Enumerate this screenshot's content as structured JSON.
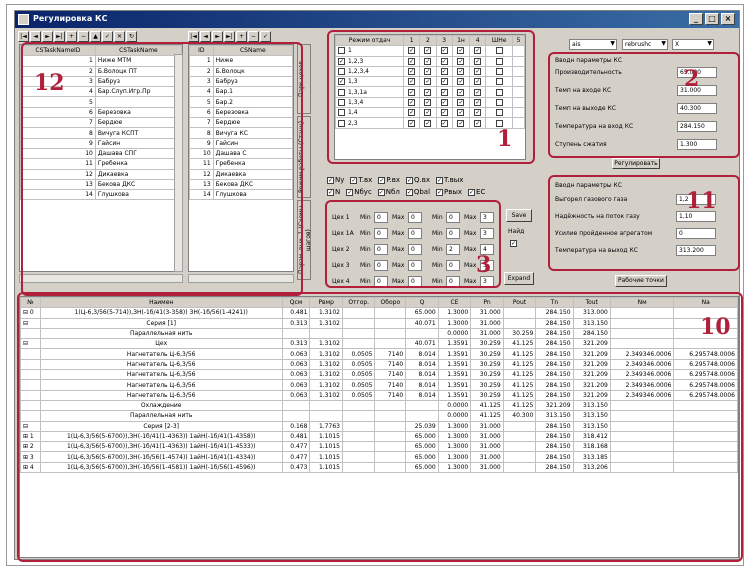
{
  "window": {
    "title": "Регулировка КС",
    "controls": [
      "_",
      "□",
      "×"
    ]
  },
  "nav_buttons": [
    "|◄",
    "◄",
    "►",
    "►|",
    "+",
    "−",
    "▲",
    "✓",
    "✕",
    "↻"
  ],
  "left_grid": {
    "headers": [
      "CSTaskNameID",
      "CSTaskName"
    ],
    "rows": [
      [
        "1",
        "Ниже МТМ"
      ],
      [
        "2",
        "Б.Волоцк ПТ"
      ],
      [
        "3",
        "Бабруз"
      ],
      [
        "4",
        "Бар.Слуп.Игр.Пр"
      ],
      [
        "5",
        ""
      ],
      [
        "6",
        "Березовка"
      ],
      [
        "7",
        "Бердюе"
      ],
      [
        "8",
        "Вичуга КСПТ"
      ],
      [
        "9",
        "Гайсин"
      ],
      [
        "10",
        "Дашава СПГ"
      ],
      [
        "11",
        "Гребенка"
      ],
      [
        "12",
        "Дикаевка"
      ],
      [
        "13",
        "Бекова ДКС"
      ],
      [
        "14",
        "Глушкова"
      ]
    ]
  },
  "mid_grid": {
    "headers": [
      "ID",
      "CSName"
    ],
    "rows": [
      [
        "1",
        "Ниже"
      ],
      [
        "2",
        "Б.Волоцк"
      ],
      [
        "3",
        "Бабруз"
      ],
      [
        "4",
        "Бар.1"
      ],
      [
        "5",
        "Бар.2"
      ],
      [
        "6",
        "Березовка"
      ],
      [
        "7",
        "Бердюе"
      ],
      [
        "8",
        "Вичуга КС"
      ],
      [
        "9",
        "Гайсин"
      ],
      [
        "10",
        "Дашава С"
      ],
      [
        "11",
        "Гребенка"
      ],
      [
        "12",
        "Дикаевка"
      ],
      [
        "13",
        "Бекова ДКС"
      ],
      [
        "14",
        "Глушкова"
      ]
    ]
  },
  "vertical_tabs": [
    "Парк цехов",
    "Режим работы (Станц)",
    "Парам. вых. 1 (Схемы шагов)"
  ],
  "modes_grid": {
    "headers": [
      "Режим отдач",
      "1",
      "2",
      "3",
      "1н",
      "4",
      "ШНе",
      "5"
    ],
    "rows": [
      {
        "checked": false,
        "label": "1"
      },
      {
        "checked": true,
        "label": "1,2,3"
      },
      {
        "checked": false,
        "label": "1,2,3,4"
      },
      {
        "checked": true,
        "label": "1,3"
      },
      {
        "checked": false,
        "label": "1,3,1а"
      },
      {
        "checked": false,
        "label": "1,3,4"
      },
      {
        "checked": false,
        "label": "1,4"
      },
      {
        "checked": false,
        "label": "2,3"
      }
    ]
  },
  "check_rows": {
    "row1": [
      "Nу",
      "T.вх",
      "P.вх",
      "Q.вх",
      "T.вых"
    ],
    "row2": [
      "N",
      "Nбус",
      "Nбл",
      "Qbal",
      "Pвых",
      "EC"
    ]
  },
  "shop_rows": {
    "labels": [
      "Цех 1",
      "Цех 1А",
      "Цех 2",
      "Цех 3",
      "Цех 4"
    ],
    "min_label": "Min",
    "max_label": "Max",
    "values": [
      [
        "0",
        "0",
        "0",
        "3"
      ],
      [
        "0",
        "0",
        "0",
        "3"
      ],
      [
        "0",
        "0",
        "2",
        "4"
      ],
      [
        "0",
        "0",
        "0",
        "3"
      ],
      [
        "0",
        "0",
        "0",
        "3"
      ]
    ],
    "save_btn": "Save",
    "nayd_label": "Найд",
    "expand_btn": "Expand"
  },
  "selectors": [
    "ais",
    "rebrushc",
    "X"
  ],
  "panel2": {
    "title": "Вводн параметры КС",
    "fields": [
      {
        "label": "Производительность",
        "value": "65.000"
      },
      {
        "label": "Темп на входе КС",
        "value": "31.000"
      },
      {
        "label": "Темп на выходе КС",
        "value": "40.300"
      },
      {
        "label": "Температура на вход КС",
        "value": "284.150"
      },
      {
        "label": "Ступень сжатия",
        "value": "1.300"
      }
    ],
    "button": "Регулировать"
  },
  "panel11": {
    "title": "Вводн параметры КС",
    "fields": [
      {
        "label": "Выгорел газового газа",
        "value": "1,2"
      },
      {
        "label": "Надёжность на поток газу",
        "value": "1,10"
      },
      {
        "label": "Усилие пройденное агрегатом",
        "value": "0"
      },
      {
        "label": "Температура на выход КС",
        "value": "313.200"
      }
    ],
    "button": "Рабочие точки"
  },
  "bottom_table": {
    "headers": [
      "№",
      "Наимен",
      "Qсм",
      "Рвмр",
      "Отгор.",
      "Оборо",
      "Q",
      "СЕ",
      "Pn",
      "Pout",
      "Tn",
      "Tout",
      "Nм",
      "Nа"
    ],
    "rows": [
      [
        "⊟ 0",
        "1(Ц-6,3/56(5-714)),ЗН(-1б/41(3-358)) ЗН(-1б/56(1-4241))",
        "0.481",
        "1.3102",
        "",
        "",
        "65.000",
        "1.3000",
        "31.000",
        "",
        "284.150",
        "313.000",
        "",
        ""
      ],
      [
        "⊟",
        "Серия [1]",
        "0.313",
        "1.3102",
        "",
        "",
        "40.071",
        "1.3000",
        "31.000",
        "",
        "284.150",
        "313.150",
        "",
        ""
      ],
      [
        "",
        "Параллельная нить",
        "",
        "",
        "",
        "",
        "",
        "0.0000",
        "31.000",
        "30.259",
        "284.150",
        "284.150",
        "",
        ""
      ],
      [
        "⊟",
        "Цех",
        "0.313",
        "1.3102",
        "",
        "",
        "40.071",
        "1.3591",
        "30.259",
        "41.125",
        "284.150",
        "321.209",
        "",
        ""
      ],
      [
        "",
        "Нагнетатель Ц-6,3/56",
        "0.063",
        "1.3102",
        "0.0505",
        "7140",
        "8.014",
        "1.3591",
        "30.259",
        "41.125",
        "284.150",
        "321.209",
        "2.349346.0006",
        "6.295748.0006"
      ],
      [
        "",
        "Нагнетатель Ц-6,3/56",
        "0.063",
        "1.3102",
        "0.0505",
        "7140",
        "8.014",
        "1.3591",
        "30.259",
        "41.125",
        "284.150",
        "321.209",
        "2.349346.0006",
        "6.295748.0006"
      ],
      [
        "",
        "Нагнетатель Ц-6,3/56",
        "0.063",
        "1.3102",
        "0.0505",
        "7140",
        "8.014",
        "1.3591",
        "30.259",
        "41.125",
        "284.150",
        "321.209",
        "2.349346.0006",
        "6.295748.0006"
      ],
      [
        "",
        "Нагнетатель Ц-6,3/56",
        "0.063",
        "1.3102",
        "0.0505",
        "7140",
        "8.014",
        "1.3591",
        "30.259",
        "41.125",
        "284.150",
        "321.209",
        "2.349346.0006",
        "6.295748.0006"
      ],
      [
        "",
        "Нагнетатель Ц-6,3/56",
        "0.063",
        "1.3102",
        "0.0505",
        "7140",
        "8.014",
        "1.3591",
        "30.259",
        "41.125",
        "284.150",
        "321.209",
        "2.349346.0006",
        "6.295748.0006"
      ],
      [
        "",
        "Охлаждение",
        "",
        "",
        "",
        "",
        "",
        "0.0000",
        "41.125",
        "41.125",
        "321.209",
        "313.150",
        "",
        ""
      ],
      [
        "",
        "Параллельная нить",
        "",
        "",
        "",
        "",
        "",
        "0.0000",
        "41.125",
        "40.300",
        "313.150",
        "313.150",
        "",
        ""
      ],
      [
        "⊟",
        "Серия [2-3]",
        "0.168",
        "1.7763",
        "",
        "",
        "25.039",
        "1.3000",
        "31.000",
        "",
        "284.150",
        "313.150",
        "",
        ""
      ],
      [
        "⊞ 1",
        "1(Ц-6,3/56(5-6700)),ЗН(-1б/41(1-4363)) 1айН(-1б/41(1-4358))",
        "0.481",
        "1.1015",
        "",
        "",
        "65.000",
        "1.3000",
        "31.000",
        "",
        "284.150",
        "318.412",
        "",
        ""
      ],
      [
        "⊞ 2",
        "1(Ц-6,3/56(5-6700)),ЗН(-1б/41(1-4363)) 1айН(-1б/41(1-4533))",
        "0.477",
        "1.1015",
        "",
        "",
        "65.000",
        "1.3000",
        "31.000",
        "",
        "284.150",
        "318.168",
        "",
        ""
      ],
      [
        "⊞ 3",
        "1(Ц-6,3/56(5-6700)),ЗН(-1б/56(1-4574)) 1айН(-1б/41(1-4334))",
        "0.477",
        "1.1015",
        "",
        "",
        "65.000",
        "1.3000",
        "31.000",
        "",
        "284.150",
        "313.185",
        "",
        ""
      ],
      [
        "⊞ 4",
        "1(Ц-6,3/56(5-6700)),ЗН(-1б/56(1-4581)) 1айН(-1б/56(1-4596))",
        "0.473",
        "1.1015",
        "",
        "",
        "65.000",
        "1.3000",
        "31.000",
        "",
        "284.150",
        "313.206",
        "",
        ""
      ]
    ]
  },
  "annotations": [
    "12",
    "1",
    "2",
    "11",
    "3",
    "10"
  ],
  "colors": {
    "annotation": "#b0203a",
    "title_bar": "#0a246a",
    "chrome": "#d4d0c8"
  }
}
